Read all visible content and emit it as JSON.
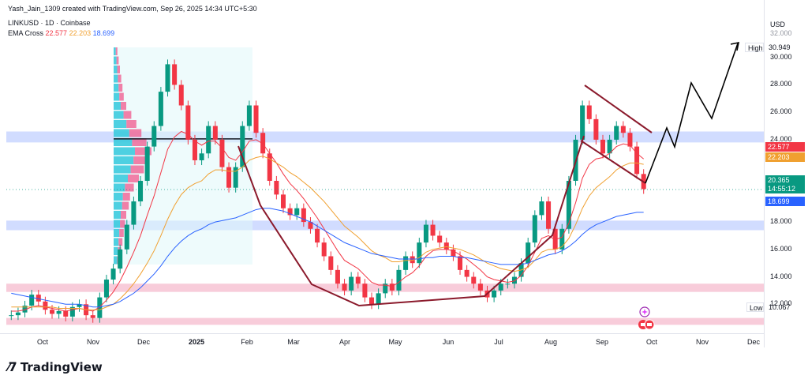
{
  "header": {
    "created_line": "Yash_Jain_1309 created with TradingView.com, Sep 26, 2025 14:34 UTC+5:30",
    "symbol_line": "LINKUSD · 1D · Coinbase",
    "ema_label": "EMA Cross",
    "ema_values": [
      "22.577",
      "22.203",
      "18.699"
    ]
  },
  "axis": {
    "currency": "USD",
    "y_ticks": [
      "30.000",
      "28.000",
      "26.000",
      "24.000",
      "18.000",
      "16.000",
      "14.000",
      "12.000"
    ],
    "y_tick_values": [
      30,
      28,
      26,
      24,
      18,
      16,
      14,
      12
    ],
    "y_top_clip": "32.000",
    "x_ticks": [
      "Oct",
      "Nov",
      "Dec",
      "2025",
      "Feb",
      "Mar",
      "Apr",
      "May",
      "Jun",
      "Jul",
      "Aug",
      "Sep",
      "Oct",
      "Nov",
      "Dec"
    ]
  },
  "price_tags": {
    "high_label": "High",
    "high_value": "30.949",
    "low_label": "Low",
    "low_value": "10.067",
    "ema_fast": "22.577",
    "ema_mid": "22.203",
    "last_price": "20.365",
    "countdown": "14:55:12",
    "ema_slow": "18.699"
  },
  "colors": {
    "up": "#089981",
    "down": "#f23645",
    "ema_fast": "#f23645",
    "ema_mid": "#f0a030",
    "ema_slow": "#2962ff",
    "blue_zone": "#c9d6ff",
    "pink_zone": "#f7c6d6",
    "pattern": "#8b1a2c",
    "projection": "#000000"
  },
  "zones": {
    "blue": [
      [
        24.6,
        23.8
      ],
      [
        18.1,
        17.4
      ]
    ],
    "pink": [
      [
        13.5,
        12.9
      ],
      [
        11.0,
        10.5
      ]
    ]
  },
  "chart_data": {
    "type": "candlestick",
    "series": [
      {
        "name": "LINKUSD",
        "values": [
          11.2,
          11.4,
          11.9,
          12.7,
          12.2,
          11.6,
          11.3,
          11.5,
          11.1,
          11.8,
          12.0,
          11.2,
          11.0,
          12.5,
          13.8,
          14.6,
          16.0,
          17.8,
          19.5,
          21.0,
          23.5,
          25.0,
          27.5,
          29.5,
          28.0,
          26.5,
          24.0,
          22.5,
          23.0,
          25.0,
          24.0,
          22.0,
          20.5,
          22.0,
          25.0,
          26.5,
          24.5,
          23.0,
          21.0,
          20.0,
          19.0,
          18.5,
          19.0,
          18.0,
          17.5,
          16.5,
          15.5,
          14.5,
          13.5,
          13.0,
          14.0,
          13.5,
          12.5,
          12.0,
          12.8,
          13.5,
          13.0,
          14.5,
          15.5,
          15.0,
          16.5,
          17.8,
          17.0,
          16.5,
          16.0,
          15.5,
          14.5,
          14.0,
          13.5,
          13.0,
          12.5,
          13.0,
          13.5,
          13.5,
          14.0,
          15.0,
          16.5,
          18.5,
          19.5,
          17.5,
          16.0,
          17.5,
          21.0,
          24.0,
          26.5,
          25.5,
          24.0,
          23.0,
          24.0,
          25.0,
          24.5,
          23.5,
          21.5,
          20.4
        ]
      },
      {
        "name": "EMA Cross",
        "values": [
          11.5,
          11.5,
          11.6,
          11.8,
          11.9,
          11.8,
          11.7,
          11.6,
          11.5,
          11.6,
          11.7,
          11.6,
          11.5,
          11.8,
          12.3,
          12.9,
          13.7,
          14.7,
          15.8,
          17.0,
          18.5,
          19.9,
          21.6,
          23.3,
          24.2,
          24.6,
          24.4,
          23.9,
          23.6,
          23.9,
          23.9,
          23.4,
          22.7,
          22.5,
          23.1,
          23.9,
          24.0,
          23.7,
          23.0,
          22.3,
          21.5,
          20.8,
          20.3,
          19.7,
          19.0,
          18.3,
          17.5,
          16.7,
          15.9,
          15.2,
          14.9,
          14.6,
          14.1,
          13.6,
          13.4,
          13.4,
          13.3,
          13.6,
          14.0,
          14.3,
          14.8,
          15.5,
          15.9,
          16.0,
          16.0,
          15.9,
          15.6,
          15.3,
          14.9,
          14.5,
          14.0,
          13.8,
          13.7,
          13.6,
          13.7,
          14.1,
          14.8,
          15.8,
          16.8,
          17.0,
          16.7,
          16.9,
          17.9,
          19.4,
          21.2,
          22.2,
          22.6,
          22.7,
          23.0,
          23.5,
          23.7,
          23.6,
          23.0,
          22.6
        ]
      },
      {
        "name": "EMA Cross",
        "values": [
          11.8,
          11.8,
          11.8,
          11.8,
          11.8,
          11.8,
          11.8,
          11.7,
          11.7,
          11.7,
          11.7,
          11.6,
          11.6,
          11.6,
          11.8,
          12.0,
          12.4,
          12.9,
          13.5,
          14.2,
          15.0,
          15.9,
          17.0,
          18.2,
          19.2,
          20.0,
          20.5,
          20.8,
          21.0,
          21.5,
          21.8,
          21.8,
          21.7,
          21.7,
          22.0,
          22.5,
          22.7,
          22.8,
          22.6,
          22.3,
          22.0,
          21.6,
          21.3,
          20.9,
          20.5,
          20.0,
          19.5,
          18.9,
          18.3,
          17.7,
          17.3,
          16.9,
          16.4,
          15.9,
          15.6,
          15.4,
          15.1,
          15.1,
          15.2,
          15.2,
          15.4,
          15.8,
          16.0,
          16.1,
          16.2,
          16.1,
          16.0,
          15.8,
          15.6,
          15.3,
          15.0,
          14.8,
          14.6,
          14.5,
          14.4,
          14.5,
          14.7,
          15.2,
          15.8,
          16.0,
          16.0,
          16.2,
          16.8,
          17.8,
          19.0,
          19.9,
          20.5,
          20.9,
          21.3,
          21.8,
          22.1,
          22.3,
          22.3,
          22.2
        ]
      },
      {
        "name": "EMA Cross",
        "values": [
          12.8,
          12.7,
          12.6,
          12.5,
          12.4,
          12.3,
          12.2,
          12.1,
          12.0,
          12.0,
          12.0,
          11.9,
          11.8,
          11.8,
          11.9,
          12.0,
          12.2,
          12.5,
          12.8,
          13.2,
          13.7,
          14.2,
          14.8,
          15.5,
          16.1,
          16.6,
          17.0,
          17.3,
          17.5,
          17.8,
          18.0,
          18.1,
          18.2,
          18.3,
          18.5,
          18.7,
          18.9,
          19.0,
          19.0,
          18.9,
          18.8,
          18.6,
          18.4,
          18.2,
          18.0,
          17.7,
          17.4,
          17.1,
          16.8,
          16.5,
          16.3,
          16.1,
          15.9,
          15.7,
          15.6,
          15.5,
          15.4,
          15.3,
          15.3,
          15.3,
          15.3,
          15.4,
          15.4,
          15.5,
          15.5,
          15.5,
          15.4,
          15.4,
          15.3,
          15.2,
          15.1,
          15.0,
          14.9,
          14.9,
          14.9,
          14.9,
          15.0,
          15.2,
          15.4,
          15.6,
          15.7,
          15.9,
          16.2,
          16.6,
          17.1,
          17.5,
          17.8,
          18.0,
          18.2,
          18.4,
          18.5,
          18.6,
          18.7,
          18.7
        ]
      }
    ],
    "ylim": [
      10.0,
      32.0
    ],
    "xlabel": "",
    "ylabel": "",
    "x_range": [
      "Sep 2024",
      "Dec 2025"
    ],
    "pattern": "cup-and-handle with descending channel",
    "grid": true
  }
}
